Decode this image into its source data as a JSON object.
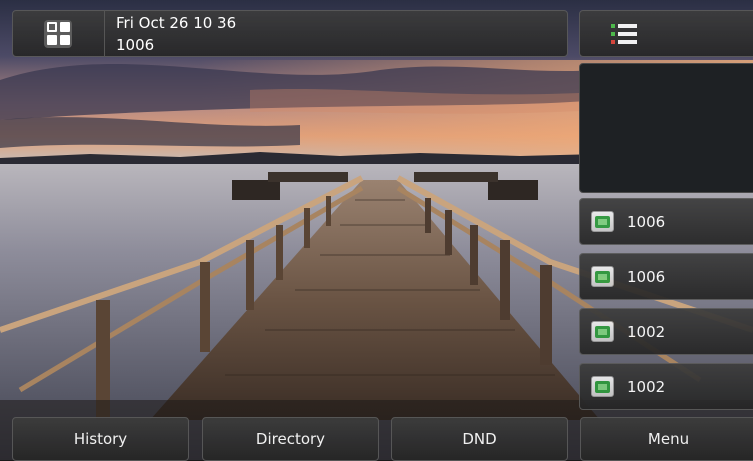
{
  "status_bar": {
    "datetime": "Fri Oct 26 10 36",
    "account": "1006"
  },
  "line_keys": [
    {
      "label": "1006",
      "icon": "line-registered-icon"
    },
    {
      "label": "1006",
      "icon": "line-registered-icon"
    },
    {
      "label": "1002",
      "icon": "line-registered-icon"
    },
    {
      "label": "1002",
      "icon": "line-registered-icon"
    }
  ],
  "softkeys": {
    "history": "History",
    "directory": "Directory",
    "dnd": "DND",
    "menu": "Menu"
  },
  "colors": {
    "line_icon_green": "#2e9a3c",
    "menu_icon_green": "#4fc24b",
    "menu_icon_red": "#e0463a"
  }
}
